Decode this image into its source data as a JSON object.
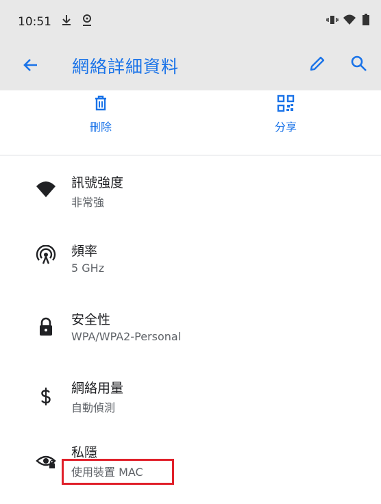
{
  "status_bar": {
    "time": "10:51",
    "icons": [
      "download-icon",
      "location-icon",
      "vibrate-icon",
      "wifi-icon",
      "battery-icon"
    ]
  },
  "app_bar": {
    "title": "網絡詳細資料",
    "back_icon": "arrow-back-icon",
    "edit_icon": "pencil-icon",
    "search_icon": "search-icon",
    "accent": "#1a73e8"
  },
  "actions": [
    {
      "label": "刪除",
      "icon": "trash-icon"
    },
    {
      "label": "分享",
      "icon": "qr-code-icon"
    }
  ],
  "details": [
    {
      "primary": "訊號強度",
      "secondary": "非常強",
      "icon": "wifi-signal-icon"
    },
    {
      "primary": "頻率",
      "secondary": "5 GHz",
      "icon": "antenna-icon"
    },
    {
      "primary": "安全性",
      "secondary": "WPA/WPA2-Personal",
      "icon": "lock-icon"
    },
    {
      "primary": "網絡用量",
      "secondary": "自動偵測",
      "icon": "dollar-icon"
    },
    {
      "primary": "私隱",
      "secondary": "使用裝置 MAC",
      "icon": "privacy-eye-icon"
    }
  ],
  "highlight_color": "#e0202a"
}
